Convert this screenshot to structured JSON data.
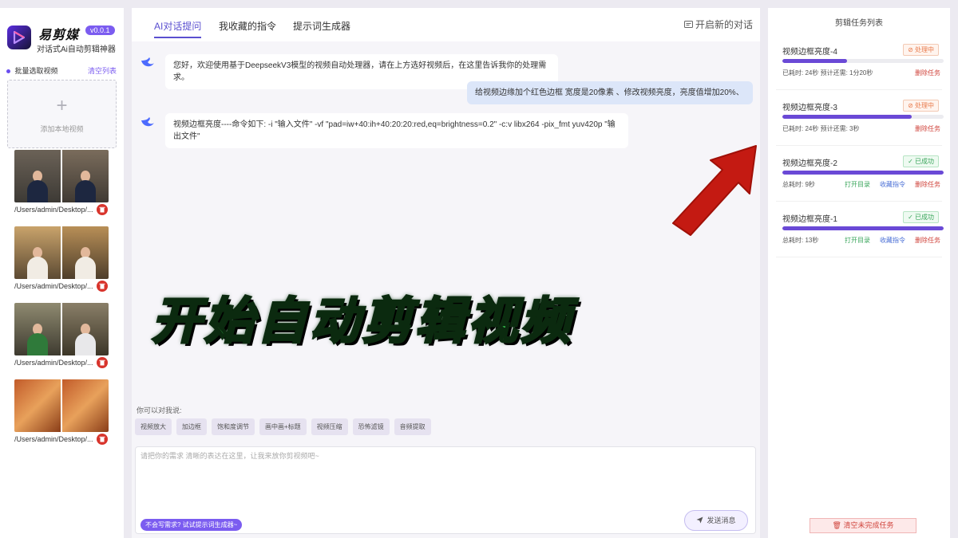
{
  "app": {
    "name": "易剪媒",
    "version": "v0.0.1",
    "tagline": "对话式Ai自动剪辑神器"
  },
  "sidebar": {
    "batch_label": "批量选取视频",
    "clear_label": "清空列表",
    "add_label": "添加本地视频",
    "videos": [
      {
        "path": "/Users/admin/Desktop/..."
      },
      {
        "path": "/Users/admin/Desktop/..."
      },
      {
        "path": "/Users/admin/Desktop/..."
      },
      {
        "path": "/Users/admin/Desktop/..."
      }
    ]
  },
  "chat": {
    "tabs": [
      {
        "label": "AI对话提问"
      },
      {
        "label": "我收藏的指令"
      },
      {
        "label": "提示词生成器"
      }
    ],
    "new_chat_label": "开启新的对话",
    "messages": [
      {
        "role": "bot",
        "text": "您好，欢迎使用基于DeepseekV3模型的视频自动处理器，请在上方选好视频后，在这里告诉我你的处理需求。"
      },
      {
        "role": "user",
        "text": "给视频边缘加个红色边框 宽度是20像素 、修改视频亮度，亮度值增加20%、"
      },
      {
        "role": "bot",
        "text": "视频边框亮度----命令如下: -i \"输入文件\" -vf \"pad=iw+40:ih+40:20:20:red,eq=brightness=0.2\" -c:v libx264 -pix_fmt yuv420p \"输出文件\""
      }
    ],
    "suggest_title": "你可以对我说:",
    "chips": [
      "视频放大",
      "加边框",
      "饱和度调节",
      "画中画+标题",
      "视频压缩",
      "恐怖滤镜",
      "音频提取"
    ],
    "input_placeholder": "请把你的需求 清晰的表达在这里，让我来放你剪视频吧~",
    "prompt_tip": "不会写需求? 试试提示词生成器~",
    "send_label": "发送消息",
    "overlay_text": "开始自动剪辑视频"
  },
  "tasks": {
    "title": "剪辑任务列表",
    "items": [
      {
        "name": "视频边框亮度-4",
        "status": "处理中",
        "progress": 0.4,
        "meta": "已耗时: 24秒   预计还需: 1分20秒",
        "delete": "删除任务"
      },
      {
        "name": "视频边框亮度-3",
        "status": "处理中",
        "progress": 0.8,
        "meta": "已耗时: 24秒   预计还需: 3秒",
        "delete": "删除任务"
      },
      {
        "name": "视频边框亮度-2",
        "status": "已成功",
        "progress": 1.0,
        "meta": "总耗时: 9秒",
        "open": "打开目录",
        "save": "收藏指令",
        "delete": "删除任务"
      },
      {
        "name": "视频边框亮度-1",
        "status": "已成功",
        "progress": 1.0,
        "meta": "总耗时: 13秒",
        "open": "打开目录",
        "save": "收藏指令",
        "delete": "删除任务"
      }
    ],
    "clear_unfinished": "清空未完成任务"
  },
  "colors": {
    "accent": "#6a49d6",
    "processing": "#e8794a",
    "success": "#3aa55b",
    "danger": "#d0443c",
    "overlay_text": "#3fe05a",
    "arrow": "#c41a12"
  }
}
